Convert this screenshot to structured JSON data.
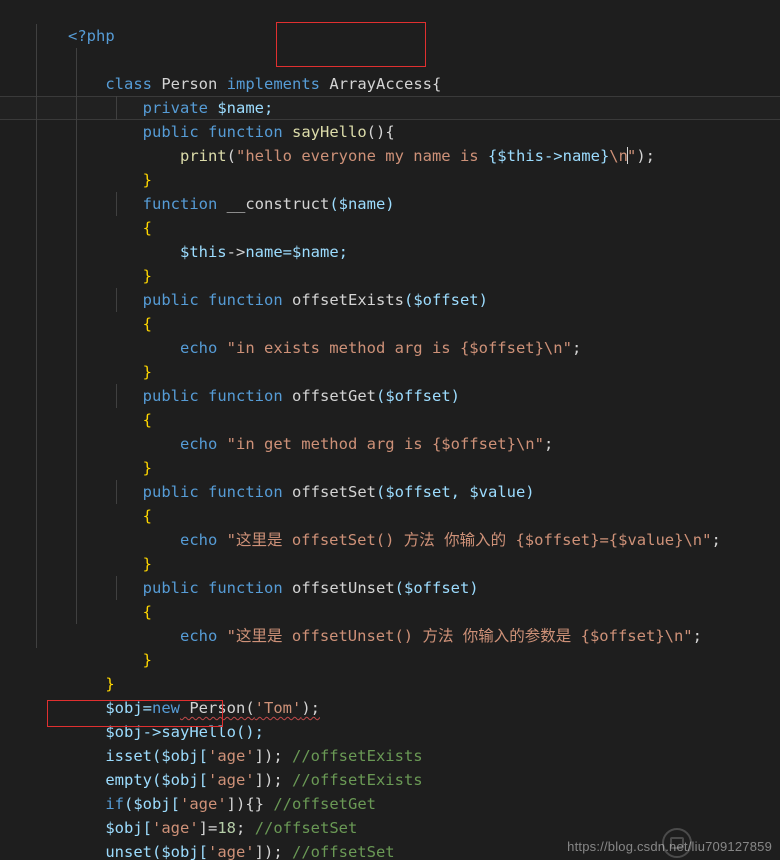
{
  "editor": {
    "language": "php",
    "theme": "dark-plus",
    "background_color": "#1e1e1e",
    "foreground_color": "#d4d4d4",
    "indent_guide_color": "#404040",
    "annotation_color": "#e03030",
    "line_height_px": 24,
    "font_size_px": 15.5
  },
  "palette": {
    "keyword": "#569cd6",
    "function": "#dcdcaa",
    "variable": "#9cdcfe",
    "string": "#ce9178",
    "number": "#b5cea8",
    "comment": "#6a9955",
    "punctuation": "#d4d4d4",
    "brace": "#ffd700"
  },
  "code": {
    "line_01": "<?php",
    "line_02_kw_class": "class",
    "line_02_name": "Person",
    "line_02_kw_implements": "implements",
    "line_02_interface": "ArrayAccess{",
    "line_03_kw": "private",
    "line_03_var": "$name;",
    "line_04_kw1": "public",
    "line_04_kw2": "function",
    "line_04_fn": "sayHello",
    "line_04_tail": "(){",
    "line_05_fn": "print",
    "line_05_open": "(",
    "line_05_str_a": "\"hello everyone my name is ",
    "line_05_interp": "{$this->name}",
    "line_05_esc": "\\n",
    "line_05_str_b": "\"",
    "line_05_close": ");",
    "line_06_brace": "}",
    "line_07_kw": "function",
    "line_07_fn": "__construct",
    "line_07_args": "($name)",
    "line_08_brace": "{",
    "line_09_var": "$this",
    "line_09_arrow": "->",
    "line_09_prop": "name=",
    "line_09_val": "$name;",
    "line_10_brace": "}",
    "line_11_kw1": "public",
    "line_11_kw2": "function",
    "line_11_fn": "offsetExists",
    "line_11_args": "($offset)",
    "line_12_brace": "{",
    "line_13_kw": "echo",
    "line_13_str": "\"in exists method arg is {$offset}\\n\"",
    "line_13_semi": ";",
    "line_14_brace": "}",
    "line_15_kw1": "public",
    "line_15_kw2": "function",
    "line_15_fn": "offsetGet",
    "line_15_args": "($offset)",
    "line_16_brace": "{",
    "line_17_kw": "echo",
    "line_17_str": "\"in get method arg is {$offset}\\n\"",
    "line_17_semi": ";",
    "line_18_brace": "}",
    "line_19_kw1": "public",
    "line_19_kw2": "function",
    "line_19_fn": "offsetSet",
    "line_19_args": "($offset, $value)",
    "line_20_brace": "{",
    "line_21_kw": "echo",
    "line_21_str": "\"这里是 offsetSet() 方法 你输入的 {$offset}={$value}\\n\"",
    "line_21_semi": ";",
    "line_22_brace": "}",
    "line_23_kw1": "public",
    "line_23_kw2": "function",
    "line_23_fn": "offsetUnset",
    "line_23_args": "($offset)",
    "line_24_brace": "{",
    "line_25_kw": "echo",
    "line_25_str": "\"这里是 offsetUnset() 方法 你输入的参数是 {$offset}\\n\"",
    "line_25_semi": ";",
    "line_26_brace": "}",
    "line_27_brace": "}",
    "line_29_var": "$obj=",
    "line_29_kw_new": "new",
    "line_29_cls": " Person(",
    "line_29_str": "'Tom'",
    "line_29_tail": ");",
    "line_30": "$obj->sayHello();",
    "line_31_fn": "isset($obj[",
    "line_31_str": "'age'",
    "line_31_tail": "]); ",
    "line_31_cmt": "//offsetExists",
    "line_32_fn": "empty($obj[",
    "line_32_str": "'age'",
    "line_32_tail": "]); ",
    "line_32_cmt": "//offsetExists",
    "line_33_kw": "if",
    "line_33_open": "($obj[",
    "line_33_str": "'age'",
    "line_33_tail": "]){} ",
    "line_33_cmt": "//offsetGet",
    "line_34_var": "$obj[",
    "line_34_str": "'age'",
    "line_34_eq": "]=",
    "line_34_num": "18",
    "line_34_semi": "; ",
    "line_34_cmt": "//offsetSet",
    "line_35_fn": "unset($obj[",
    "line_35_str": "'age'",
    "line_35_tail": "]); ",
    "line_35_cmt": "//offsetSet"
  },
  "annotations": {
    "box_1_target": "ArrayAccess{",
    "box_2_target": "$obj->sayHello();"
  },
  "watermark": {
    "text": "https://blog.csdn.net/liu709127859"
  }
}
